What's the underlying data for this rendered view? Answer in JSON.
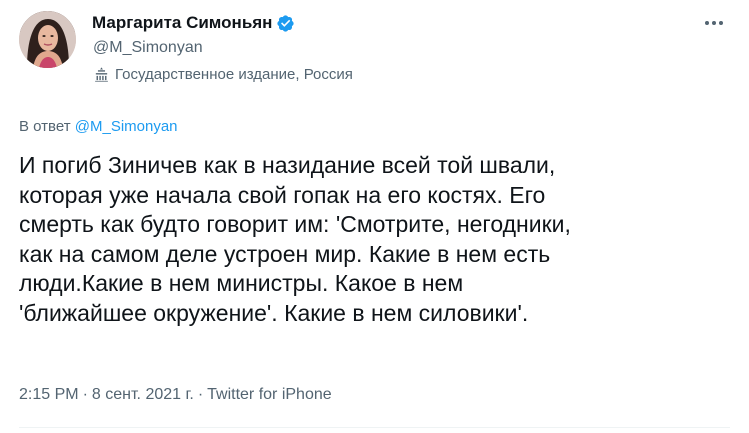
{
  "author": {
    "name": "Маргарита Симоньян",
    "handle": "@M_Simonyan",
    "label": "Государственное издание, Россия",
    "verified": true
  },
  "reply": {
    "prefix": "В ответ",
    "to": "@M_Simonyan"
  },
  "tweet": {
    "text": "И погиб Зиничев как в назидание всей той швали,\nкоторая уже начала свой гопак на его костях. Его\nсмерть как будто говорит им: 'Смотрите, негодники,\nкак на самом деле устроен мир. Какие в нем есть\nлюди.Какие в нем министры. Какое в нем\n'ближайшее окружение'. Какие в нем силовики'."
  },
  "meta": {
    "time": "2:15 PM",
    "separator1": "·",
    "date": "8 сент. 2021 г.",
    "separator2": "·",
    "source": "Twitter for iPhone"
  },
  "colors": {
    "accent": "#1d9bf0",
    "secondary_text": "#536471",
    "primary_text": "#0f1419"
  },
  "icons": {
    "verified": "verified-badge-icon",
    "label": "state-media-icon",
    "more": "more-options-icon"
  }
}
